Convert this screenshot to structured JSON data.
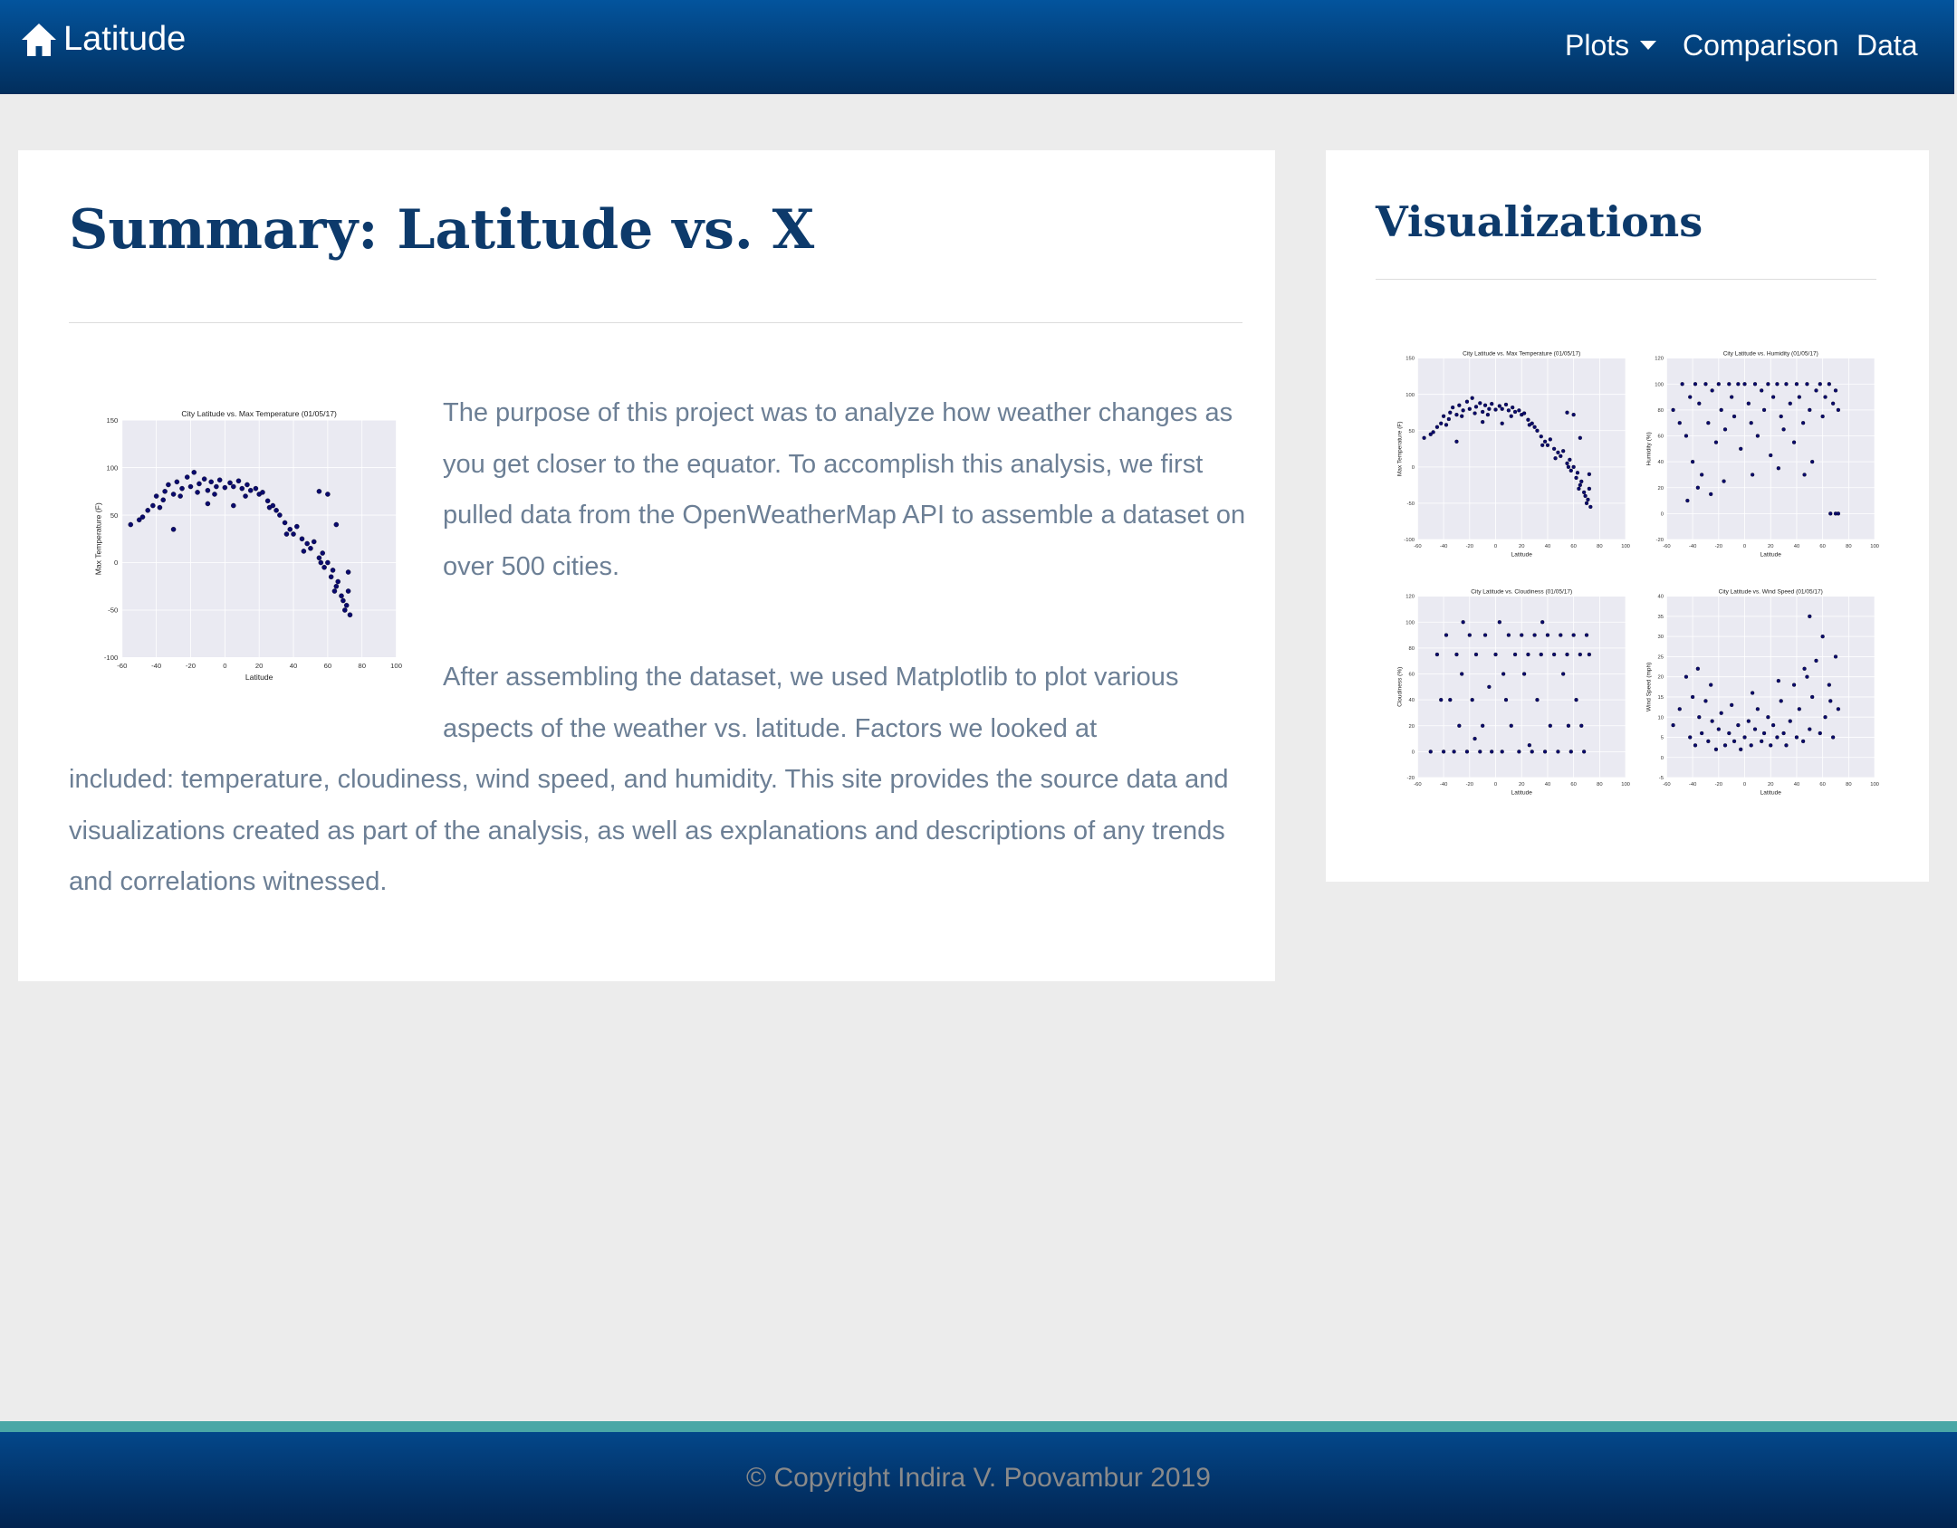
{
  "navbar": {
    "brand": "Latitude",
    "brand_icon": "home-icon",
    "items": [
      {
        "label": "Plots",
        "dropdown": true
      },
      {
        "label": "Comparison"
      },
      {
        "label": "Data"
      }
    ]
  },
  "main": {
    "title": "Summary: Latitude vs. X",
    "paragraph1": "The purpose of this project was to analyze how weather changes as you get closer to the equator. To accomplish this analysis, we first pulled data from the OpenWeatherMap API to assemble a dataset on over 500 cities.",
    "paragraph2_part1": "After assembling the dataset, we used Matplotlib to plot various aspects of the weather vs. latitude. Factors we looked at",
    "paragraph2_part2": "included: temperature, cloudiness, wind speed, and humidity. This site provides the source data and visualizations created as part of the analysis, as well as explanations and descriptions of any trends and correlations witnessed."
  },
  "sidebar": {
    "title": "Visualizations"
  },
  "footer": {
    "copyright": "© Copyright Indira V. Poovambur 2019"
  },
  "colors": {
    "navbar_top": "#03549d",
    "navbar_bottom": "#022e5c",
    "heading": "#0d3a6b",
    "body_text": "#6c7f95",
    "footer_accent": "#4aa7a6",
    "point": "#0a0a6e"
  },
  "chart_data": [
    {
      "id": "temp",
      "type": "scatter",
      "title": "City Latitude vs. Max Temperature (01/05/17)",
      "xlabel": "Latitude",
      "ylabel": "Max Temperature (F)",
      "xlim": [
        -60,
        100
      ],
      "ylim": [
        -100,
        150
      ],
      "xticks": [
        -60,
        -40,
        -20,
        0,
        20,
        40,
        60,
        80,
        100
      ],
      "yticks": [
        -100,
        -50,
        0,
        50,
        100,
        150
      ],
      "grid": true,
      "points": [
        [
          -55,
          40
        ],
        [
          -50,
          45
        ],
        [
          -45,
          55
        ],
        [
          -42,
          60
        ],
        [
          -40,
          70
        ],
        [
          -38,
          58
        ],
        [
          -35,
          75
        ],
        [
          -33,
          82
        ],
        [
          -30,
          72
        ],
        [
          -28,
          85
        ],
        [
          -25,
          78
        ],
        [
          -22,
          90
        ],
        [
          -20,
          80
        ],
        [
          -18,
          95
        ],
        [
          -15,
          83
        ],
        [
          -12,
          88
        ],
        [
          -10,
          76
        ],
        [
          -8,
          85
        ],
        [
          -5,
          80
        ],
        [
          -3,
          87
        ],
        [
          0,
          79
        ],
        [
          3,
          84
        ],
        [
          5,
          80
        ],
        [
          8,
          86
        ],
        [
          10,
          78
        ],
        [
          13,
          82
        ],
        [
          15,
          76
        ],
        [
          18,
          78
        ],
        [
          20,
          72
        ],
        [
          22,
          74
        ],
        [
          25,
          65
        ],
        [
          28,
          60
        ],
        [
          30,
          55
        ],
        [
          32,
          50
        ],
        [
          35,
          42
        ],
        [
          38,
          35
        ],
        [
          40,
          30
        ],
        [
          42,
          38
        ],
        [
          45,
          25
        ],
        [
          48,
          20
        ],
        [
          50,
          15
        ],
        [
          52,
          22
        ],
        [
          55,
          5
        ],
        [
          57,
          10
        ],
        [
          58,
          -5
        ],
        [
          60,
          0
        ],
        [
          62,
          -15
        ],
        [
          63,
          -8
        ],
        [
          65,
          -25
        ],
        [
          66,
          -20
        ],
        [
          68,
          -35
        ],
        [
          69,
          -40
        ],
        [
          70,
          -50
        ],
        [
          71,
          -45
        ],
        [
          72,
          -30
        ],
        [
          73,
          -55
        ],
        [
          -30,
          35
        ],
        [
          -48,
          48
        ],
        [
          -10,
          62
        ],
        [
          5,
          60
        ],
        [
          55,
          75
        ],
        [
          60,
          72
        ],
        [
          65,
          40
        ],
        [
          72,
          -10
        ],
        [
          -36,
          66
        ],
        [
          -26,
          70
        ],
        [
          -16,
          74
        ],
        [
          -6,
          72
        ],
        [
          12,
          70
        ],
        [
          26,
          58
        ],
        [
          36,
          30
        ],
        [
          46,
          12
        ],
        [
          56,
          0
        ],
        [
          64,
          -30
        ]
      ]
    },
    {
      "id": "humidity",
      "type": "scatter",
      "title": "City Latitude vs. Humidity (01/05/17)",
      "xlabel": "Latitude",
      "ylabel": "Humidity (%)",
      "xlim": [
        -60,
        100
      ],
      "ylim": [
        -20,
        120
      ],
      "xticks": [
        -60,
        -40,
        -20,
        0,
        20,
        40,
        60,
        80,
        100
      ],
      "yticks": [
        -20,
        0,
        20,
        40,
        60,
        80,
        100,
        120
      ],
      "grid": true,
      "points": [
        [
          -55,
          80
        ],
        [
          -50,
          70
        ],
        [
          -48,
          100
        ],
        [
          -45,
          60
        ],
        [
          -42,
          90
        ],
        [
          -40,
          40
        ],
        [
          -38,
          100
        ],
        [
          -35,
          85
        ],
        [
          -33,
          30
        ],
        [
          -30,
          100
        ],
        [
          -28,
          70
        ],
        [
          -25,
          95
        ],
        [
          -22,
          55
        ],
        [
          -20,
          100
        ],
        [
          -18,
          80
        ],
        [
          -15,
          65
        ],
        [
          -12,
          100
        ],
        [
          -10,
          90
        ],
        [
          -8,
          75
        ],
        [
          -5,
          100
        ],
        [
          -3,
          50
        ],
        [
          0,
          100
        ],
        [
          3,
          85
        ],
        [
          5,
          70
        ],
        [
          8,
          100
        ],
        [
          10,
          60
        ],
        [
          13,
          95
        ],
        [
          15,
          80
        ],
        [
          18,
          100
        ],
        [
          20,
          45
        ],
        [
          22,
          90
        ],
        [
          25,
          100
        ],
        [
          28,
          75
        ],
        [
          30,
          65
        ],
        [
          32,
          100
        ],
        [
          35,
          85
        ],
        [
          38,
          55
        ],
        [
          40,
          100
        ],
        [
          42,
          90
        ],
        [
          45,
          70
        ],
        [
          48,
          100
        ],
        [
          50,
          80
        ],
        [
          52,
          40
        ],
        [
          55,
          95
        ],
        [
          58,
          100
        ],
        [
          60,
          75
        ],
        [
          62,
          90
        ],
        [
          65,
          100
        ],
        [
          68,
          85
        ],
        [
          70,
          95
        ],
        [
          72,
          80
        ],
        [
          -36,
          20
        ],
        [
          -26,
          15
        ],
        [
          -16,
          25
        ],
        [
          6,
          30
        ],
        [
          26,
          35
        ],
        [
          46,
          30
        ],
        [
          66,
          0
        ],
        [
          70,
          0
        ],
        [
          72,
          0
        ],
        [
          -44,
          10
        ]
      ]
    },
    {
      "id": "cloudiness",
      "type": "scatter",
      "title": "City Latitude vs. Cloudiness (01/05/17)",
      "xlabel": "Latitude",
      "ylabel": "Cloudiness (%)",
      "xlim": [
        -60,
        100
      ],
      "ylim": [
        -20,
        120
      ],
      "xticks": [
        -60,
        -40,
        -20,
        0,
        20,
        40,
        60,
        80,
        100
      ],
      "yticks": [
        -20,
        0,
        20,
        40,
        60,
        80,
        100,
        120
      ],
      "grid": true,
      "points": [
        [
          -50,
          0
        ],
        [
          -45,
          75
        ],
        [
          -40,
          0
        ],
        [
          -38,
          90
        ],
        [
          -35,
          40
        ],
        [
          -32,
          0
        ],
        [
          -30,
          75
        ],
        [
          -28,
          20
        ],
        [
          -25,
          100
        ],
        [
          -22,
          0
        ],
        [
          -20,
          90
        ],
        [
          -18,
          40
        ],
        [
          -15,
          75
        ],
        [
          -12,
          0
        ],
        [
          -10,
          20
        ],
        [
          -8,
          90
        ],
        [
          -5,
          50
        ],
        [
          -3,
          0
        ],
        [
          0,
          75
        ],
        [
          3,
          100
        ],
        [
          5,
          0
        ],
        [
          8,
          40
        ],
        [
          10,
          90
        ],
        [
          12,
          20
        ],
        [
          15,
          75
        ],
        [
          18,
          0
        ],
        [
          20,
          90
        ],
        [
          22,
          60
        ],
        [
          25,
          75
        ],
        [
          28,
          0
        ],
        [
          30,
          90
        ],
        [
          32,
          40
        ],
        [
          35,
          75
        ],
        [
          38,
          0
        ],
        [
          40,
          90
        ],
        [
          42,
          20
        ],
        [
          45,
          75
        ],
        [
          48,
          0
        ],
        [
          50,
          90
        ],
        [
          52,
          60
        ],
        [
          55,
          75
        ],
        [
          58,
          0
        ],
        [
          60,
          90
        ],
        [
          62,
          40
        ],
        [
          65,
          75
        ],
        [
          68,
          0
        ],
        [
          70,
          90
        ],
        [
          72,
          75
        ],
        [
          -42,
          40
        ],
        [
          -26,
          60
        ],
        [
          6,
          60
        ],
        [
          36,
          100
        ],
        [
          56,
          20
        ],
        [
          66,
          20
        ],
        [
          -16,
          10
        ],
        [
          26,
          5
        ]
      ]
    },
    {
      "id": "wind",
      "type": "scatter",
      "title": "City Latitude vs. Wind Speed (01/05/17)",
      "xlabel": "Latitude",
      "ylabel": "Wind Speed (mph)",
      "xlim": [
        -60,
        100
      ],
      "ylim": [
        -5,
        40
      ],
      "xticks": [
        -60,
        -40,
        -20,
        0,
        20,
        40,
        60,
        80,
        100
      ],
      "yticks": [
        -5,
        0,
        5,
        10,
        15,
        20,
        25,
        30,
        35,
        40
      ],
      "grid": true,
      "points": [
        [
          -55,
          8
        ],
        [
          -50,
          12
        ],
        [
          -45,
          20
        ],
        [
          -42,
          5
        ],
        [
          -40,
          15
        ],
        [
          -38,
          3
        ],
        [
          -35,
          10
        ],
        [
          -33,
          6
        ],
        [
          -30,
          14
        ],
        [
          -28,
          4
        ],
        [
          -25,
          9
        ],
        [
          -22,
          2
        ],
        [
          -20,
          7
        ],
        [
          -18,
          11
        ],
        [
          -15,
          3
        ],
        [
          -12,
          6
        ],
        [
          -10,
          13
        ],
        [
          -8,
          4
        ],
        [
          -5,
          8
        ],
        [
          -3,
          2
        ],
        [
          0,
          5
        ],
        [
          3,
          9
        ],
        [
          5,
          3
        ],
        [
          8,
          7
        ],
        [
          10,
          12
        ],
        [
          13,
          4
        ],
        [
          15,
          6
        ],
        [
          18,
          10
        ],
        [
          20,
          3
        ],
        [
          22,
          8
        ],
        [
          25,
          5
        ],
        [
          28,
          14
        ],
        [
          30,
          6
        ],
        [
          32,
          3
        ],
        [
          35,
          9
        ],
        [
          38,
          18
        ],
        [
          40,
          5
        ],
        [
          42,
          12
        ],
        [
          45,
          4
        ],
        [
          48,
          20
        ],
        [
          50,
          7
        ],
        [
          52,
          15
        ],
        [
          55,
          24
        ],
        [
          58,
          6
        ],
        [
          60,
          30
        ],
        [
          62,
          10
        ],
        [
          65,
          18
        ],
        [
          68,
          5
        ],
        [
          70,
          25
        ],
        [
          72,
          12
        ],
        [
          50,
          35
        ],
        [
          -36,
          22
        ],
        [
          -26,
          18
        ],
        [
          6,
          16
        ],
        [
          26,
          19
        ],
        [
          46,
          22
        ],
        [
          66,
          14
        ]
      ]
    }
  ]
}
